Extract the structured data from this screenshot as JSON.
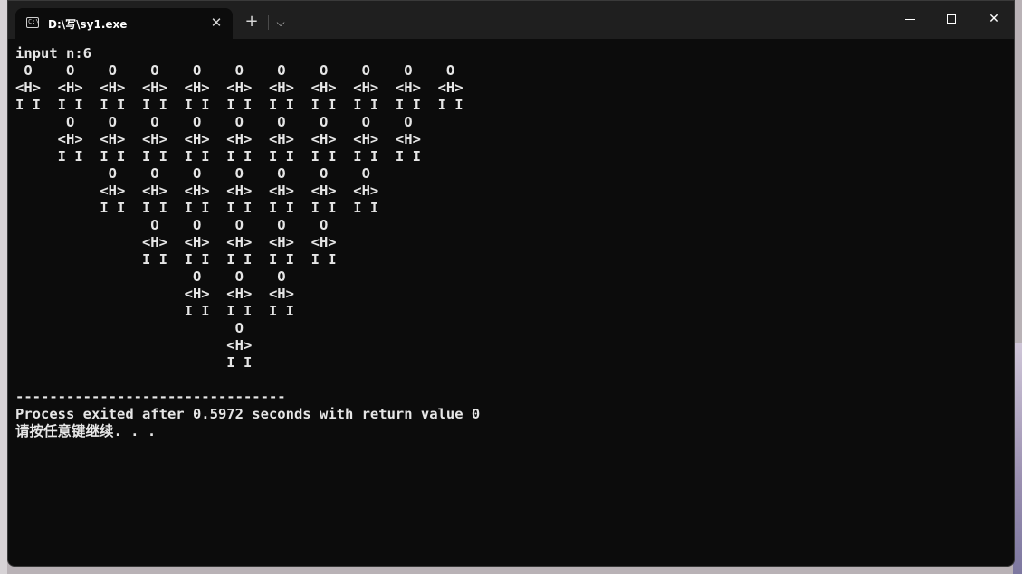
{
  "window": {
    "tab_icon_text": "C:\\",
    "tab_title": "D:\\写\\sy1.exe",
    "tab_close_glyph": "✕",
    "new_tab_glyph": "+",
    "dropdown_glyph": "⌵",
    "close_glyph": "✕"
  },
  "console": {
    "lines": [
      "input n:6",
      " O    O    O    O    O    O    O    O    O    O    O",
      "<H>  <H>  <H>  <H>  <H>  <H>  <H>  <H>  <H>  <H>  <H>",
      "I I  I I  I I  I I  I I  I I  I I  I I  I I  I I  I I",
      "      O    O    O    O    O    O    O    O    O",
      "     <H>  <H>  <H>  <H>  <H>  <H>  <H>  <H>  <H>",
      "     I I  I I  I I  I I  I I  I I  I I  I I  I I",
      "           O    O    O    O    O    O    O",
      "          <H>  <H>  <H>  <H>  <H>  <H>  <H>",
      "          I I  I I  I I  I I  I I  I I  I I",
      "                O    O    O    O    O",
      "               <H>  <H>  <H>  <H>  <H>",
      "               I I  I I  I I  I I  I I",
      "                     O    O    O",
      "                    <H>  <H>  <H>",
      "                    I I  I I  I I",
      "                          O",
      "                         <H>",
      "                         I I",
      "",
      "--------------------------------",
      "Process exited after 0.5972 seconds with return value 0",
      "请按任意键继续. . ."
    ]
  }
}
